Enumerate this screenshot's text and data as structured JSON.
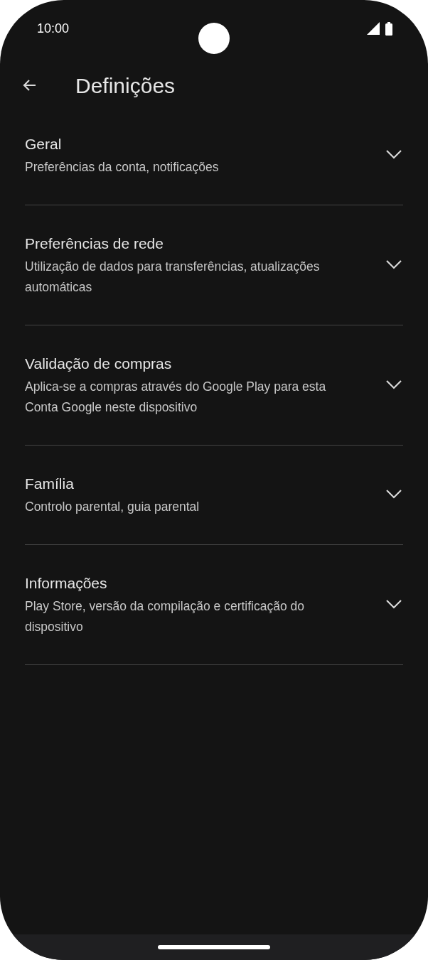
{
  "status_bar": {
    "time": "10:00"
  },
  "toolbar": {
    "title": "Definições"
  },
  "sections": [
    {
      "title": "Geral",
      "subtitle": "Preferências da conta, notificações",
      "expanded": false
    },
    {
      "title": "Preferências de rede",
      "subtitle": "Utilização de dados para transferências, atualizações automáticas",
      "expanded": false
    },
    {
      "title": "Validação de compras",
      "subtitle": "Aplica-se a compras através do Google Play para esta Conta Google neste dispositivo",
      "expanded": false
    },
    {
      "title": "Família",
      "subtitle": "Controlo parental, guia parental",
      "expanded": false
    },
    {
      "title": "Informações",
      "subtitle": "Play Store, versão da compilação e certificação do dispositivo",
      "expanded": false
    }
  ]
}
